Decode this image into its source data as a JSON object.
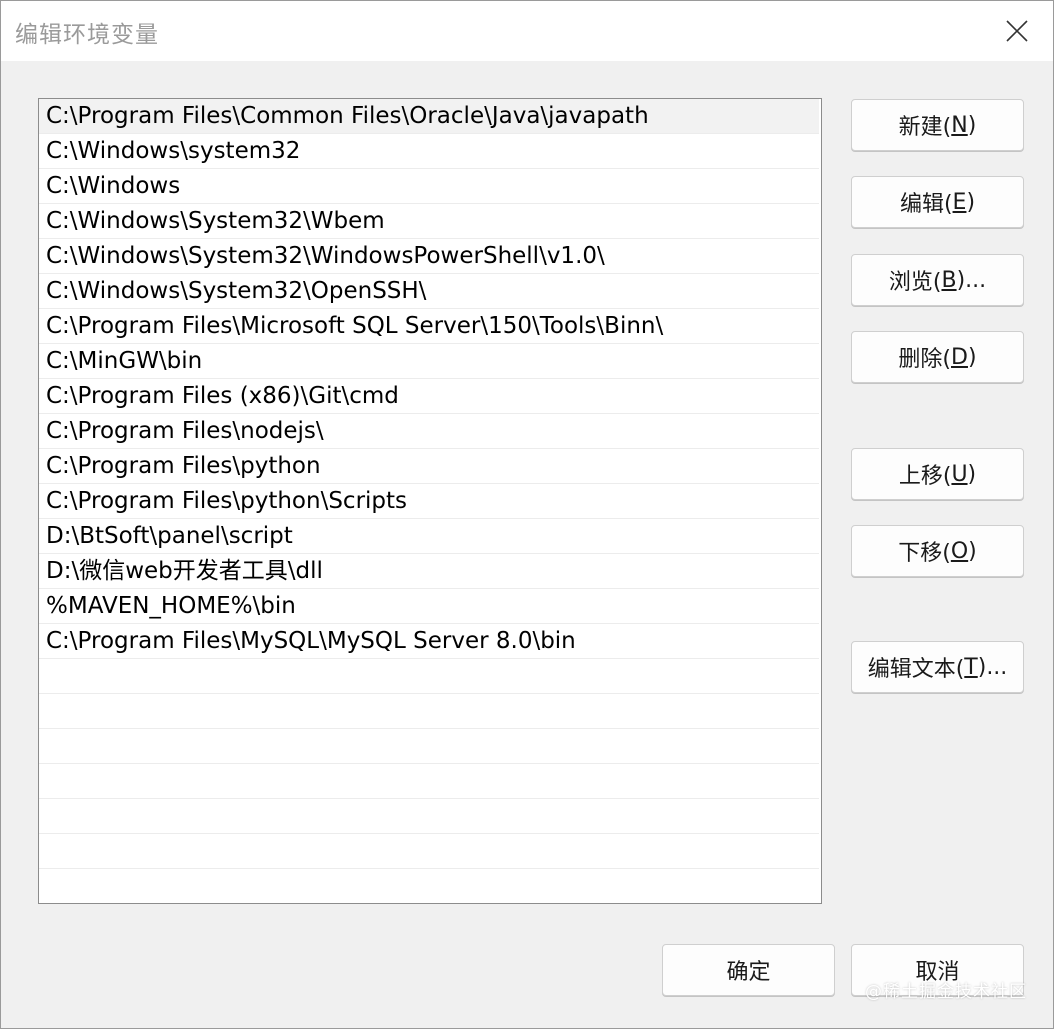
{
  "window": {
    "title": "编辑环境变量"
  },
  "list": {
    "items": [
      "C:\\Program Files\\Common Files\\Oracle\\Java\\javapath",
      "C:\\Windows\\system32",
      "C:\\Windows",
      "C:\\Windows\\System32\\Wbem",
      "C:\\Windows\\System32\\WindowsPowerShell\\v1.0\\",
      "C:\\Windows\\System32\\OpenSSH\\",
      "C:\\Program Files\\Microsoft SQL Server\\150\\Tools\\Binn\\",
      "C:\\MinGW\\bin",
      "C:\\Program Files (x86)\\Git\\cmd",
      "C:\\Program Files\\nodejs\\",
      "C:\\Program Files\\python",
      "C:\\Program Files\\python\\Scripts",
      "D:\\BtSoft\\panel\\script",
      "D:\\微信web开发者工具\\dll",
      "%MAVEN_HOME%\\bin",
      "C:\\Program Files\\MySQL\\MySQL Server 8.0\\bin"
    ],
    "selected_index": 0
  },
  "buttons": {
    "new": {
      "label": "新建(",
      "key": "N",
      "suffix": ")"
    },
    "edit": {
      "label": "编辑(",
      "key": "E",
      "suffix": ")"
    },
    "browse": {
      "label": "浏览(",
      "key": "B",
      "suffix": ")..."
    },
    "delete": {
      "label": "删除(",
      "key": "D",
      "suffix": ")"
    },
    "move_up": {
      "label": "上移(",
      "key": "U",
      "suffix": ")"
    },
    "move_down": {
      "label": "下移(",
      "key": "O",
      "suffix": ")"
    },
    "edit_text": {
      "label": "编辑文本(",
      "key": "T",
      "suffix": ")..."
    },
    "ok": {
      "label": "确定"
    },
    "cancel": {
      "label": "取消"
    }
  },
  "watermark": {
    "text": "@稀土掘金技术社区"
  },
  "icons": {
    "close": "close-icon"
  }
}
